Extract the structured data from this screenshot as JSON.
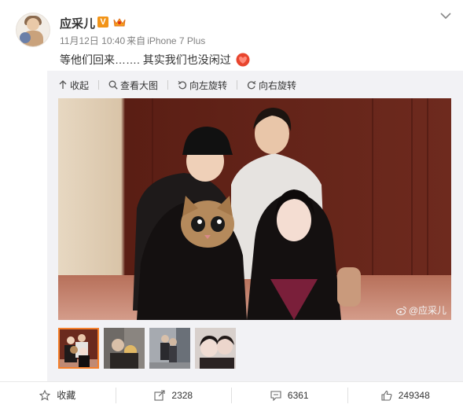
{
  "user": {
    "name": "应采儿",
    "verified_badge": "V"
  },
  "post": {
    "date": "11月12日 10:40",
    "source_prefix": "来自",
    "source": "iPhone 7 Plus",
    "text": "等他们回来……. 其实我们也没闲过"
  },
  "media_tools": {
    "collapse": "收起",
    "view_large": "查看大图",
    "rotate_left": "向左旋转",
    "rotate_right": "向右旋转"
  },
  "photo": {
    "watermark": "@应采儿"
  },
  "footer": {
    "favorite": "收藏",
    "repost_count": "2328",
    "comment_count": "6361",
    "like_count": "249348"
  },
  "colors": {
    "accent_orange": "#f29418",
    "thumb_border": "#f47f2a",
    "meta_gray": "#808080"
  }
}
